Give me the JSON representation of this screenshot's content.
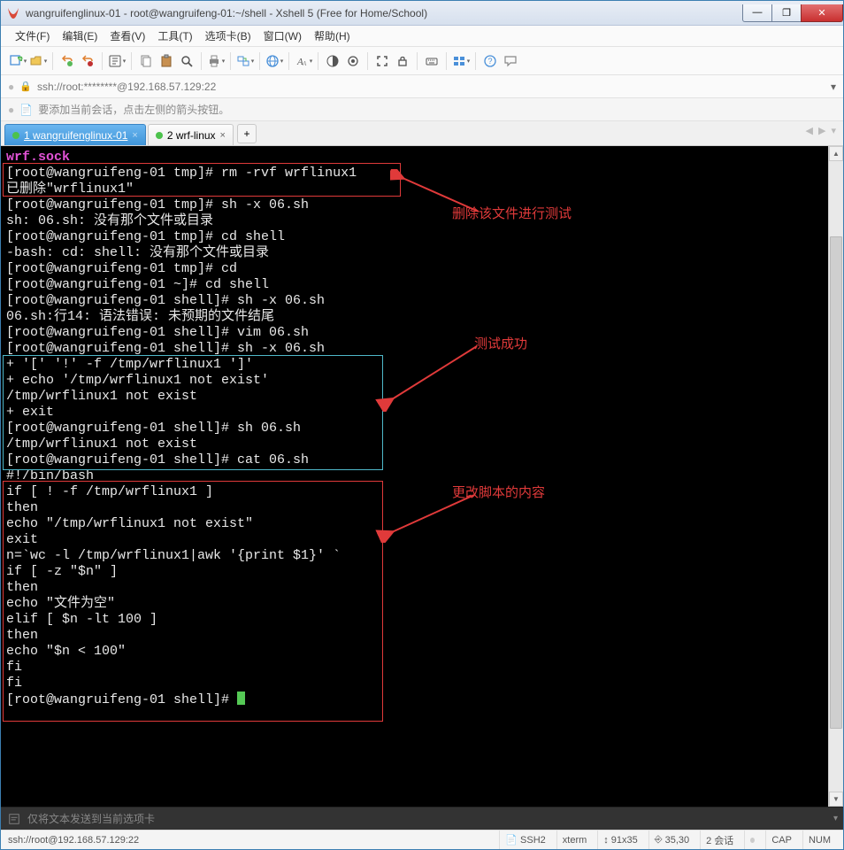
{
  "window": {
    "title": "wangruifenglinux-01 - root@wangruifeng-01:~/shell - Xshell 5 (Free for Home/School)"
  },
  "menu": {
    "file": "文件(F)",
    "edit": "编辑(E)",
    "view": "查看(V)",
    "tools": "工具(T)",
    "tabs": "选项卡(B)",
    "window": "窗口(W)",
    "help": "帮助(H)"
  },
  "addr": {
    "text": "ssh://root:********@192.168.57.129:22"
  },
  "hint": {
    "text": "要添加当前会话，点击左侧的箭头按钮。"
  },
  "tabs": {
    "t1": "1 wangruifenglinux-01",
    "t2": "2 wrf-linux",
    "add": "+"
  },
  "term": {
    "l0": "wrf.sock",
    "l1a": "[root@wangruifeng-01 tmp]# ",
    "l1b": "rm -rvf wrflinux1",
    "l2": "已删除\"wrflinux1\"",
    "l3a": "[root@wangruifeng-01 tmp]# ",
    "l3b": "sh -x 06.sh",
    "l4": "sh: 06.sh: 没有那个文件或目录",
    "l5a": "[root@wangruifeng-01 tmp]# ",
    "l5b": "cd shell",
    "l6": "-bash: cd: shell: 没有那个文件或目录",
    "l7a": "[root@wangruifeng-01 tmp]# ",
    "l7b": "cd",
    "l8a": "[root@wangruifeng-01 ~]# ",
    "l8b": "cd shell",
    "l9a": "[root@wangruifeng-01 shell]# ",
    "l9b": "sh -x 06.sh",
    "l10": "06.sh:行14: 语法错误: 未预期的文件结尾",
    "l11a": "[root@wangruifeng-01 shell]# ",
    "l11b": "vim 06.sh",
    "l12a": "[root@wangruifeng-01 shell]# ",
    "l12b": "sh -x 06.sh",
    "l13": "+ '[' '!' -f /tmp/wrflinux1 ']'",
    "l14": "+ echo '/tmp/wrflinux1 not exist'",
    "l15": "/tmp/wrflinux1 not exist",
    "l16": "+ exit",
    "l17a": "[root@wangruifeng-01 shell]# ",
    "l17b": "sh 06.sh",
    "l18": "/tmp/wrflinux1 not exist",
    "l19a": "[root@wangruifeng-01 shell]# ",
    "l19b": "cat 06.sh",
    "l20": "#!/bin/bash",
    "l21": "if [ ! -f /tmp/wrflinux1 ]",
    "l22": "then",
    "l23": "   echo \"/tmp/wrflinux1 not exist\"",
    "l24": "   exit",
    "l25": "n=`wc -l /tmp/wrflinux1|awk '{print $1}' `",
    "l26": "if [ -z \"$n\" ]",
    "l27": "then",
    "l28": "  echo \"文件为空\"",
    "l29": "elif [ $n -lt 100 ]",
    "l30": "  then",
    "l31": "  echo \"$n < 100\"",
    "l32": "  fi",
    "l33": "fi",
    "l34a": "[root@wangruifeng-01 shell]# "
  },
  "ann": {
    "a1": "删除该文件进行测试",
    "a2": "测试成功",
    "a3": "更改脚本的内容"
  },
  "input": {
    "placeholder": "仅将文本发送到当前选项卡"
  },
  "status": {
    "addr": "ssh://root@192.168.57.129:22",
    "proto": "SSH2",
    "term": "xterm",
    "size": "91x35",
    "pos": "35,30",
    "sess": "2 会话",
    "cap": "CAP",
    "num": "NUM"
  }
}
